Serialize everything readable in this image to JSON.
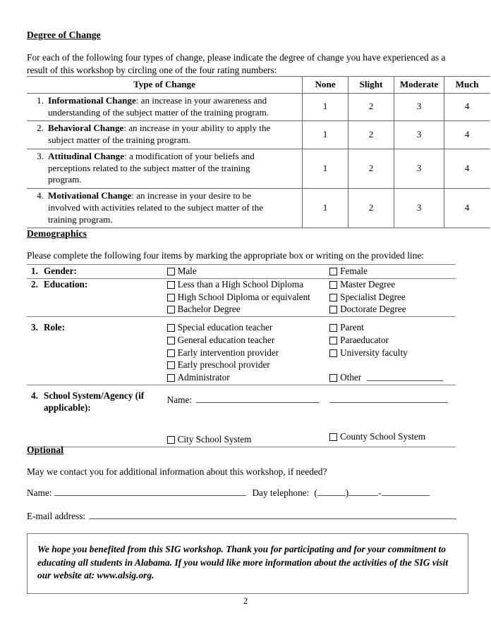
{
  "document": {
    "page_number": "2"
  },
  "degree_of_change": {
    "heading": "Degree of Change",
    "intro": "For each of the following four types of change, please indicate the degree of change you have experienced as a result of this workshop by circling one of the four rating numbers:",
    "table": {
      "headers": [
        "Type of Change",
        "None",
        "Slight",
        "Moderate",
        "Much"
      ],
      "rows": [
        {
          "num": "1.",
          "bold_label": "Informational Change",
          "text": ":  an increase in your awareness and understanding of the subject matter of the training program.",
          "ratings": [
            "1",
            "2",
            "3",
            "4"
          ]
        },
        {
          "num": "2.",
          "bold_label": "Behavioral Change",
          "text": ":  an increase in your ability to apply the subject matter of the training program.",
          "ratings": [
            "1",
            "2",
            "3",
            "4"
          ]
        },
        {
          "num": "3.",
          "bold_label": "Attitudinal Change",
          "text": ":  a modification of your beliefs and perceptions related to the subject matter of the training program.",
          "ratings": [
            "1",
            "2",
            "3",
            "4"
          ]
        },
        {
          "num": "4.",
          "bold_label": "Motivational Change",
          "text": ":  an increase in your desire to be involved with activities related to the subject matter of the training program.",
          "ratings": [
            "1",
            "2",
            "3",
            "4"
          ]
        }
      ]
    }
  },
  "demographics": {
    "heading": "Demographics",
    "intro": "Please complete the following four items by marking the appropriate box or writing on the provided line:",
    "items": [
      {
        "num": "1.",
        "label": "Gender:",
        "left_options": [
          "Male"
        ],
        "right_options": [
          "Female"
        ]
      },
      {
        "num": "2.",
        "label": "Education:",
        "left_options": [
          "Less than a High School Diploma",
          "High School Diploma or equivalent",
          "Bachelor Degree"
        ],
        "right_options": [
          "Master Degree",
          "Specialist Degree",
          "Doctorate Degree"
        ]
      },
      {
        "num": "3.",
        "label": "Role:",
        "left_options": [
          "Special education teacher",
          "General education teacher",
          "Early intervention provider",
          "Early preschool provider",
          "Administrator"
        ],
        "right_options": [
          "Parent",
          "Paraeducator",
          "University faculty"
        ],
        "other_label": "Other"
      },
      {
        "num": "4.",
        "label": "School System/Agency (if applicable):",
        "name_label": "Name:",
        "left_options": [
          "City School System"
        ],
        "right_options": [
          "County School System"
        ]
      }
    ]
  },
  "optional": {
    "heading": "Optional",
    "question": "May we contact you for additional information about this workshop, if needed?",
    "name_label": "Name:",
    "telephone_label": "Day telephone:",
    "telephone_open_paren": "(",
    "telephone_close_paren": ")",
    "telephone_dash": "-",
    "email_label": "E-mail address:"
  },
  "closing": {
    "text": "We hope you benefited from this SIG workshop.  Thank you for participating and for your commitment to educating all students in Alabama.  If you would like more information about the activities of the SIG visit our website at:  www.alsig.org."
  }
}
